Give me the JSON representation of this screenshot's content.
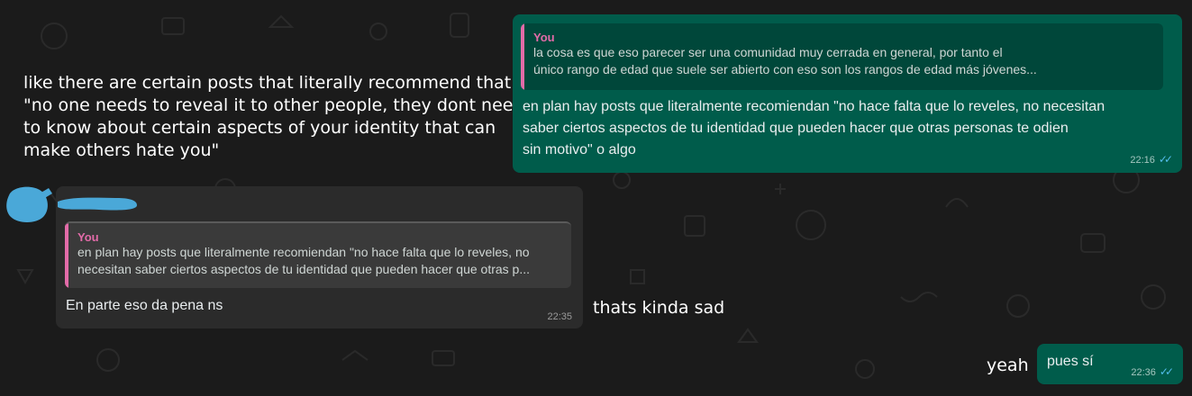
{
  "outgoing_top": {
    "quote": {
      "author": "You",
      "lines": [
        "la cosa es que eso parecer ser una comunidad muy cerrada en general, por tanto el",
        "único rango de edad que suele ser abierto con eso son los rangos de edad más jóvenes..."
      ]
    },
    "body_lines": [
      "en plan hay posts que literalmente recomiendan \"no hace falta que lo reveles, no necesitan",
      "saber ciertos aspectos de tu identidad que pueden hacer que otras personas te odien",
      "sin motivo\" o algo"
    ],
    "time": "22:16",
    "ticks": "✓✓"
  },
  "incoming": {
    "quote": {
      "author": "You",
      "lines": [
        "en plan hay posts que literalmente recomiendan \"no hace falta que lo reveles, no",
        "necesitan saber ciertos aspectos de tu identidad que pueden hacer que otras p..."
      ]
    },
    "body": "En parte eso da pena ns",
    "time": "22:35"
  },
  "outgoing_bottom": {
    "body": "pues sí",
    "time": "22:36",
    "ticks": "✓✓"
  },
  "annotations": {
    "translation_1": [
      "like there are certain posts that literally recommend that",
      "\"no one needs to reveal it to other people, they dont need",
      "to know about certain aspects of your identity that can",
      "make others hate you\""
    ],
    "translation_2": "thats kinda sad",
    "translation_3": "yeah"
  },
  "colors": {
    "background": "#1b1b1b",
    "outgoing_bubble": "#005c4b",
    "incoming_bubble": "#2b2b2b",
    "quote_accent": "#e26ba8",
    "read_ticks": "#53bdeb",
    "redaction": "#4aa8d8"
  }
}
